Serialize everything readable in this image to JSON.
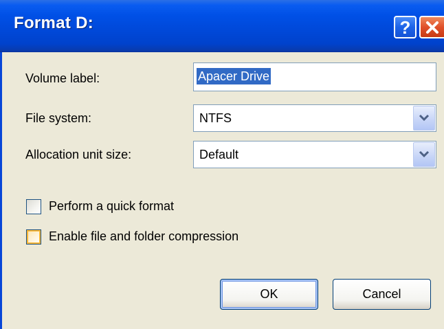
{
  "window": {
    "title": "Format D:",
    "help_glyph": "?",
    "help_icon": "question-mark-icon",
    "close_icon": "close-x-icon",
    "accent_color": "#0050e6",
    "close_color": "#e0502a"
  },
  "form": {
    "volume_label": {
      "label": "Volume label:",
      "value": "Apacer Drive"
    },
    "file_system": {
      "label": "File system:",
      "value": "NTFS"
    },
    "allocation_unit": {
      "label": "Allocation unit size:",
      "value": "Default"
    }
  },
  "options": {
    "quick_format": {
      "label": "Perform a quick format",
      "checked": false
    },
    "compression": {
      "label": "Enable file and folder compression",
      "checked": false
    }
  },
  "buttons": {
    "ok": "OK",
    "cancel": "Cancel"
  }
}
